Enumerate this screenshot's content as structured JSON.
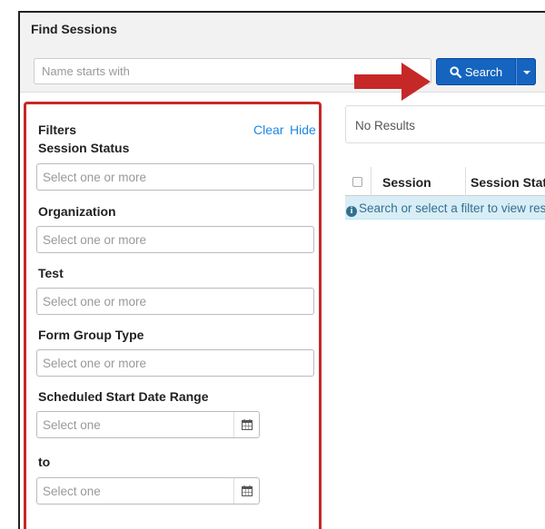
{
  "header": {
    "title": "Find Sessions"
  },
  "search": {
    "placeholder": "Name starts with",
    "button_label": "Search"
  },
  "filters": {
    "title": "Filters",
    "clear_label": "Clear",
    "hide_label": "Hide",
    "session_status": {
      "label": "Session Status",
      "placeholder": "Select one or more"
    },
    "organization": {
      "label": "Organization",
      "placeholder": "Select one or more"
    },
    "test": {
      "label": "Test",
      "placeholder": "Select one or more"
    },
    "form_group_type": {
      "label": "Form Group Type",
      "placeholder": "Select one or more"
    },
    "date_range": {
      "label": "Scheduled Start Date Range",
      "start_placeholder": "Select one",
      "to_label": "to",
      "end_placeholder": "Select one"
    }
  },
  "results": {
    "summary": "No Results",
    "columns": [
      "Session",
      "Session Status"
    ],
    "info_message": "Search or select a filter to view results"
  },
  "icons": {
    "search": "search-icon",
    "calendar": "calendar-icon",
    "info": "info-icon",
    "dropdown": "chevron-down-icon",
    "arrow": "arrow-right-icon"
  },
  "colors": {
    "primary_button": "#1565c0",
    "highlight_border": "#c62828",
    "arrow": "#c62828",
    "link": "#1e88e5",
    "info_bg": "#d9edf7"
  }
}
